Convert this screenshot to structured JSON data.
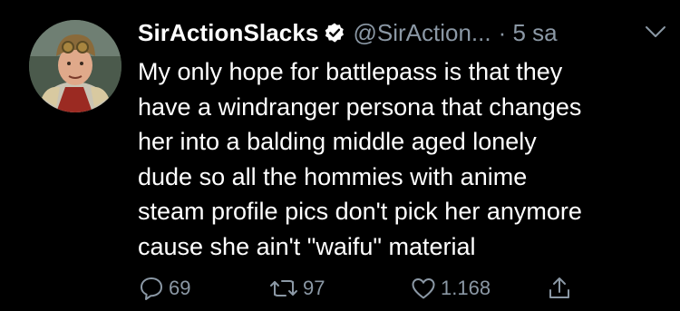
{
  "tweet": {
    "display_name": "SirActionSlacks",
    "handle": "@SirAction...",
    "time": "· 5 sa",
    "body": "My only hope for battlepass is that they\nhave a windranger persona that changes\nher into a balding middle aged lonely\ndude so all the hommies with anime\nsteam profile pics don't pick her anymore\ncause she ain't \"waifu\" material",
    "reply_count": "69",
    "retweet_count": "97",
    "like_count": "1.168"
  },
  "icons": {
    "verified": "verified-badge-icon",
    "caret": "chevron-down-icon",
    "reply": "reply-icon",
    "retweet": "retweet-icon",
    "like": "heart-icon",
    "share": "share-icon"
  },
  "colors": {
    "background": "#000000",
    "text": "#ffffff",
    "muted": "#8b98a5"
  }
}
